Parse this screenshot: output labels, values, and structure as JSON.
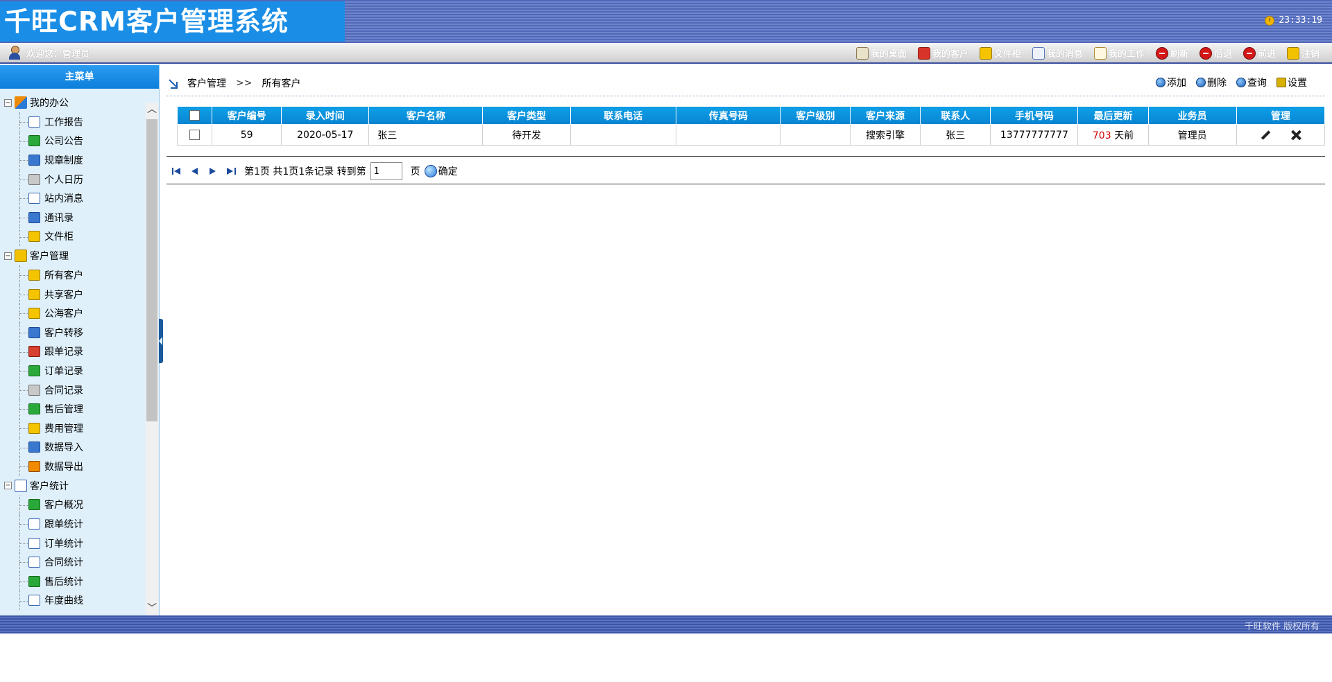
{
  "header": {
    "logo_text": "千旺CRM客户管理系统",
    "clock": "23:33:19"
  },
  "topbar": {
    "welcome": "欢迎您：管理员",
    "links": [
      {
        "label": "我的桌面",
        "icon": "desk-icon"
      },
      {
        "label": "我的客户",
        "icon": "gift-icon"
      },
      {
        "label": "文件柜",
        "icon": "folder-icon"
      },
      {
        "label": "我的消息",
        "icon": "mail-icon"
      },
      {
        "label": "我的工作",
        "icon": "pen-icon"
      },
      {
        "label": "刷新",
        "icon": "refresh-icon"
      },
      {
        "label": "后退",
        "icon": "back-icon"
      },
      {
        "label": "前进",
        "icon": "forward-icon"
      },
      {
        "label": "注销",
        "icon": "key-icon"
      }
    ]
  },
  "sidebar": {
    "title": "主菜单",
    "groups": [
      {
        "label": "我的办公",
        "items": [
          "工作报告",
          "公司公告",
          "规章制度",
          "个人日历",
          "站内消息",
          "通讯录",
          "文件柜"
        ]
      },
      {
        "label": "客户管理",
        "items": [
          "所有客户",
          "共享客户",
          "公海客户",
          "客户转移",
          "跟单记录",
          "订单记录",
          "合同记录",
          "售后管理",
          "费用管理",
          "数据导入",
          "数据导出"
        ]
      },
      {
        "label": "客户统计",
        "items": [
          "客户概况",
          "跟单统计",
          "订单统计",
          "合同统计",
          "售后统计",
          "年度曲线"
        ]
      }
    ]
  },
  "breadcrumb": {
    "root": "客户管理",
    "separator": ">>",
    "current": "所有客户"
  },
  "actions": {
    "add": "添加",
    "delete": "删除",
    "query": "查询",
    "settings": "设置"
  },
  "table": {
    "columns": [
      "客户编号",
      "录入时间",
      "客户名称",
      "客户类型",
      "联系电话",
      "传真号码",
      "客户级别",
      "客户来源",
      "联系人",
      "手机号码",
      "最后更新",
      "业务员",
      "管理"
    ],
    "rows": [
      {
        "id": "59",
        "created": "2020-05-17",
        "name": "张三",
        "type": "待开发",
        "phone": "",
        "fax": "",
        "level": "",
        "source": "搜索引擎",
        "contact": "张三",
        "mobile": "13777777777",
        "updated_days": "703",
        "updated_suffix": "天前",
        "salesperson": "管理员"
      }
    ]
  },
  "pager": {
    "summary": "第1页 共1页1条记录 转到第",
    "page_value": "1",
    "page_suffix": "页",
    "go_label": "确定"
  },
  "footer": {
    "copyright": "千旺软件 版权所有"
  },
  "colors": {
    "header_blue": "#1a8ee6",
    "table_header": "#0d9fe8",
    "sidebar_bg": "#dff0fb",
    "days_red": "#d00000"
  }
}
